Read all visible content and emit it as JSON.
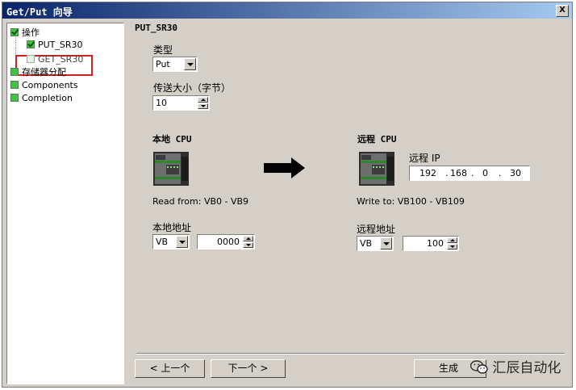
{
  "window": {
    "title": "Get/Put 向导",
    "close_label": "X"
  },
  "tree": {
    "items": [
      {
        "label": "操作",
        "checked": true
      },
      {
        "label": "PUT_SR30",
        "checked": true
      },
      {
        "label": "GET_SR30",
        "checked": false
      },
      {
        "label": "存储器分配",
        "checked": false
      },
      {
        "label": "Components",
        "checked": false
      },
      {
        "label": "Completion",
        "checked": false
      }
    ]
  },
  "page": {
    "title": "PUT_SR30",
    "type_label": "类型",
    "type_value": "Put",
    "size_label": "传送大小（字节）",
    "size_value": "10"
  },
  "local": {
    "header": "本地 CPU",
    "read_from": "Read from: VB0 - VB9",
    "address_label": "本地地址",
    "area_value": "VB",
    "address_value": "0000"
  },
  "remote": {
    "header": "远程 CPU",
    "ip_label": "远程 IP",
    "ip": [
      "192",
      "168",
      "0",
      "30"
    ],
    "write_to": "Write to: VB100 - VB109",
    "address_label": "远程地址",
    "area_value": "VB",
    "address_value": "100"
  },
  "buttons": {
    "prev": "< 上一个",
    "next": "下一个 >",
    "finish": "生成"
  },
  "watermark": "汇辰自动化"
}
